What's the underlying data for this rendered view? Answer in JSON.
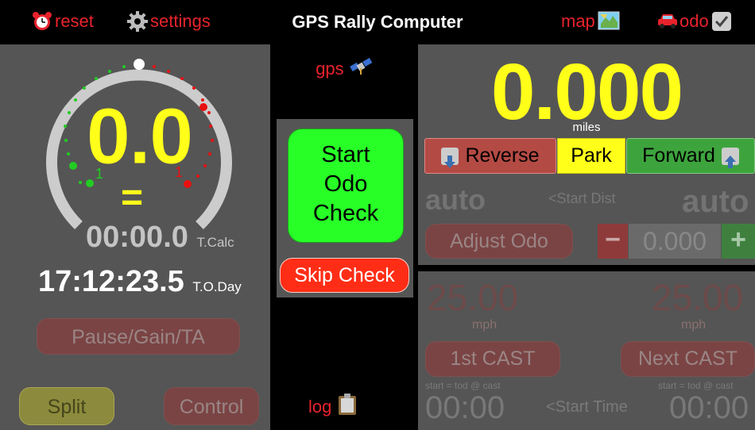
{
  "topbar": {
    "reset_label": "reset",
    "settings_label": "settings",
    "title": "GPS Rally Computer",
    "map_label": "map",
    "odo_label": "odo"
  },
  "gauge": {
    "speed": "0.0",
    "equal_sign": "=",
    "left_tick": "1",
    "right_tick": "1",
    "colors": {
      "ahead": "#22cc22",
      "behind": "#e81010",
      "top_marker": "#ffffff",
      "arc": "#cccccc"
    }
  },
  "times": {
    "tcalc_value": "00:00.0",
    "tcalc_label": "T.Calc",
    "tod_value": "17:12:23.5",
    "tod_label": "T.O.Day"
  },
  "left_buttons": {
    "pause": "Pause/Gain/TA",
    "split": "Split",
    "control": "Control"
  },
  "middle": {
    "gps_label": "gps",
    "start_check_lines": [
      "Start",
      "Odo",
      "Check"
    ],
    "skip_check": "Skip Check",
    "log_label": "log"
  },
  "odometer": {
    "value": "0.000",
    "unit": "miles",
    "reverse": "Reverse",
    "park": "Park",
    "forward": "Forward",
    "auto_left": "auto",
    "auto_right": "auto",
    "start_dist": "<Start Dist",
    "adjust_odo": "Adjust Odo",
    "minus": "−",
    "adjust_value": "0.000",
    "plus": "+"
  },
  "cast": {
    "left_speed": "25.00",
    "right_speed": "25.00",
    "left_unit": "mph",
    "right_unit": "mph",
    "first_cast": "1st CAST",
    "next_cast": "Next CAST",
    "left_note": "start = tod @ cast",
    "right_note": "start = tod @ cast",
    "left_time": "00:00",
    "right_time": "00:00",
    "start_time": "<Start Time"
  }
}
